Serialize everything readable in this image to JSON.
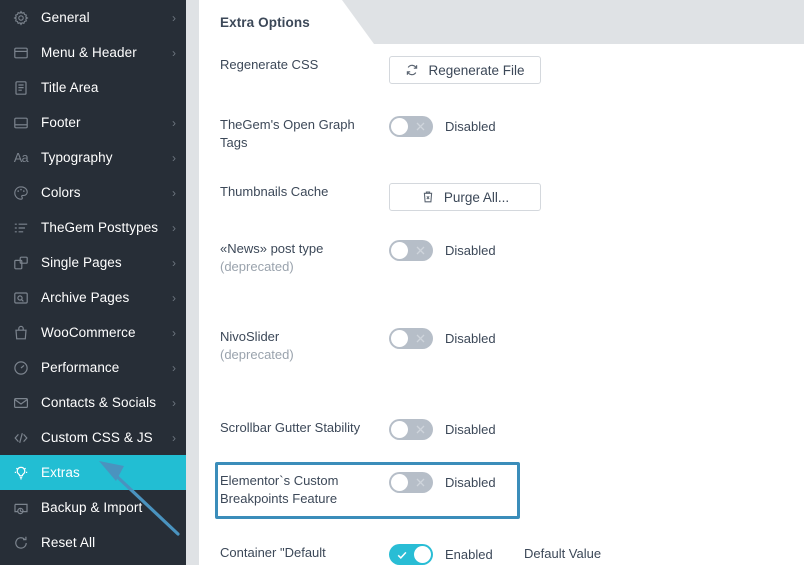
{
  "sidebar": {
    "items": [
      {
        "label": "General",
        "icon": "gear-icon",
        "chevron": "›",
        "active": false
      },
      {
        "label": "Menu & Header",
        "icon": "window-icon",
        "chevron": "›",
        "active": false
      },
      {
        "label": "Title Area",
        "icon": "document-icon",
        "chevron": "",
        "active": false
      },
      {
        "label": "Footer",
        "icon": "footer-icon",
        "chevron": "›",
        "active": false
      },
      {
        "label": "Typography",
        "icon": "typography-icon",
        "chevron": "›",
        "active": false
      },
      {
        "label": "Colors",
        "icon": "palette-icon",
        "chevron": "›",
        "active": false
      },
      {
        "label": "TheGem Posttypes",
        "icon": "list-icon",
        "chevron": "›",
        "active": false
      },
      {
        "label": "Single Pages",
        "icon": "pages-icon",
        "chevron": "›",
        "active": false
      },
      {
        "label": "Archive Pages",
        "icon": "archive-icon",
        "chevron": "›",
        "active": false
      },
      {
        "label": "WooCommerce",
        "icon": "bag-icon",
        "chevron": "›",
        "active": false
      },
      {
        "label": "Performance",
        "icon": "gauge-icon",
        "chevron": "›",
        "active": false
      },
      {
        "label": "Contacts & Socials",
        "icon": "mail-icon",
        "chevron": "›",
        "active": false
      },
      {
        "label": "Custom CSS & JS",
        "icon": "code-icon",
        "chevron": "›",
        "active": false
      },
      {
        "label": "Extras",
        "icon": "bulb-icon",
        "chevron": "",
        "active": true
      },
      {
        "label": "Backup & Import",
        "icon": "backup-icon",
        "chevron": "",
        "active": false
      },
      {
        "label": "Reset All",
        "icon": "reset-icon",
        "chevron": "",
        "active": false
      }
    ]
  },
  "tab": {
    "label": "Extra Options"
  },
  "options": {
    "regenerate_css": {
      "label": "Regenerate CSS",
      "button_label": "Regenerate File",
      "button_icon": "refresh-icon"
    },
    "open_graph": {
      "label": "TheGem's Open Graph Tags",
      "state_label": "Disabled",
      "enabled": false
    },
    "thumbnails_cache": {
      "label": "Thumbnails Cache",
      "button_label": "Purge All...",
      "button_icon": "trash-icon"
    },
    "news_post_type": {
      "label": "«News» post type",
      "sublabel": "(deprecated)",
      "state_label": "Disabled",
      "enabled": false
    },
    "nivoslider": {
      "label": "NivoSlider",
      "sublabel": "(deprecated)",
      "state_label": "Disabled",
      "enabled": false
    },
    "scrollbar_gutter": {
      "label": "Scrollbar Gutter Stability",
      "state_label": "Disabled",
      "enabled": false
    },
    "elementor_breakpoints": {
      "label": "Elementor`s Custom Breakpoints Feature",
      "state_label": "Disabled",
      "enabled": false,
      "highlighted": true
    },
    "container_default": {
      "label": "Container \"Default",
      "state_label": "Enabled",
      "enabled": true,
      "extra_label": "Default Value"
    }
  },
  "colors": {
    "sidebar_bg": "#272e37",
    "accent": "#22bed3",
    "tab_band": "#dfe2e5",
    "toggle_on": "#29bdd5",
    "toggle_off": "#b6bec8",
    "highlight_border": "#3b8dba",
    "arrow": "#4a93bf",
    "text": "#3c4858",
    "muted_text": "#9aa3ad"
  }
}
